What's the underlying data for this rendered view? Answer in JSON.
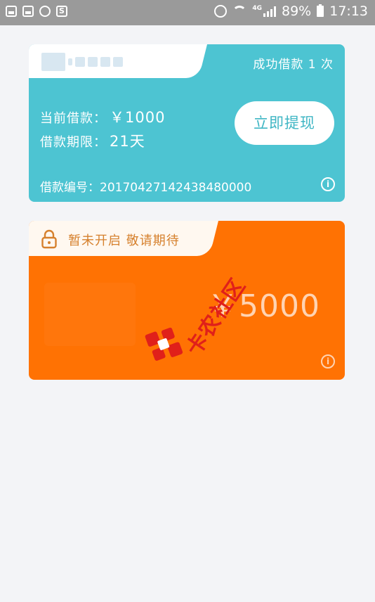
{
  "status_bar": {
    "network": "4G",
    "battery": "89%",
    "time": "17:13"
  },
  "loan_card": {
    "success_text": "成功借款 1 次",
    "current_label": "当前借款：",
    "current_value": "￥1000",
    "term_label": "借款期限：",
    "term_value": "21天",
    "withdraw_label": "立即提现",
    "number_label": "借款编号：",
    "number_value": "20170427142438480000",
    "info_icon": "i"
  },
  "locked_card": {
    "lock_text": "暂未开启 敬请期待",
    "amount": "￥5000",
    "info_icon": "i"
  },
  "watermark": {
    "text": "卡农社区"
  },
  "colors": {
    "teal": "#4dc4d2",
    "orange": "#ff7203",
    "background": "#f3f4f7"
  }
}
